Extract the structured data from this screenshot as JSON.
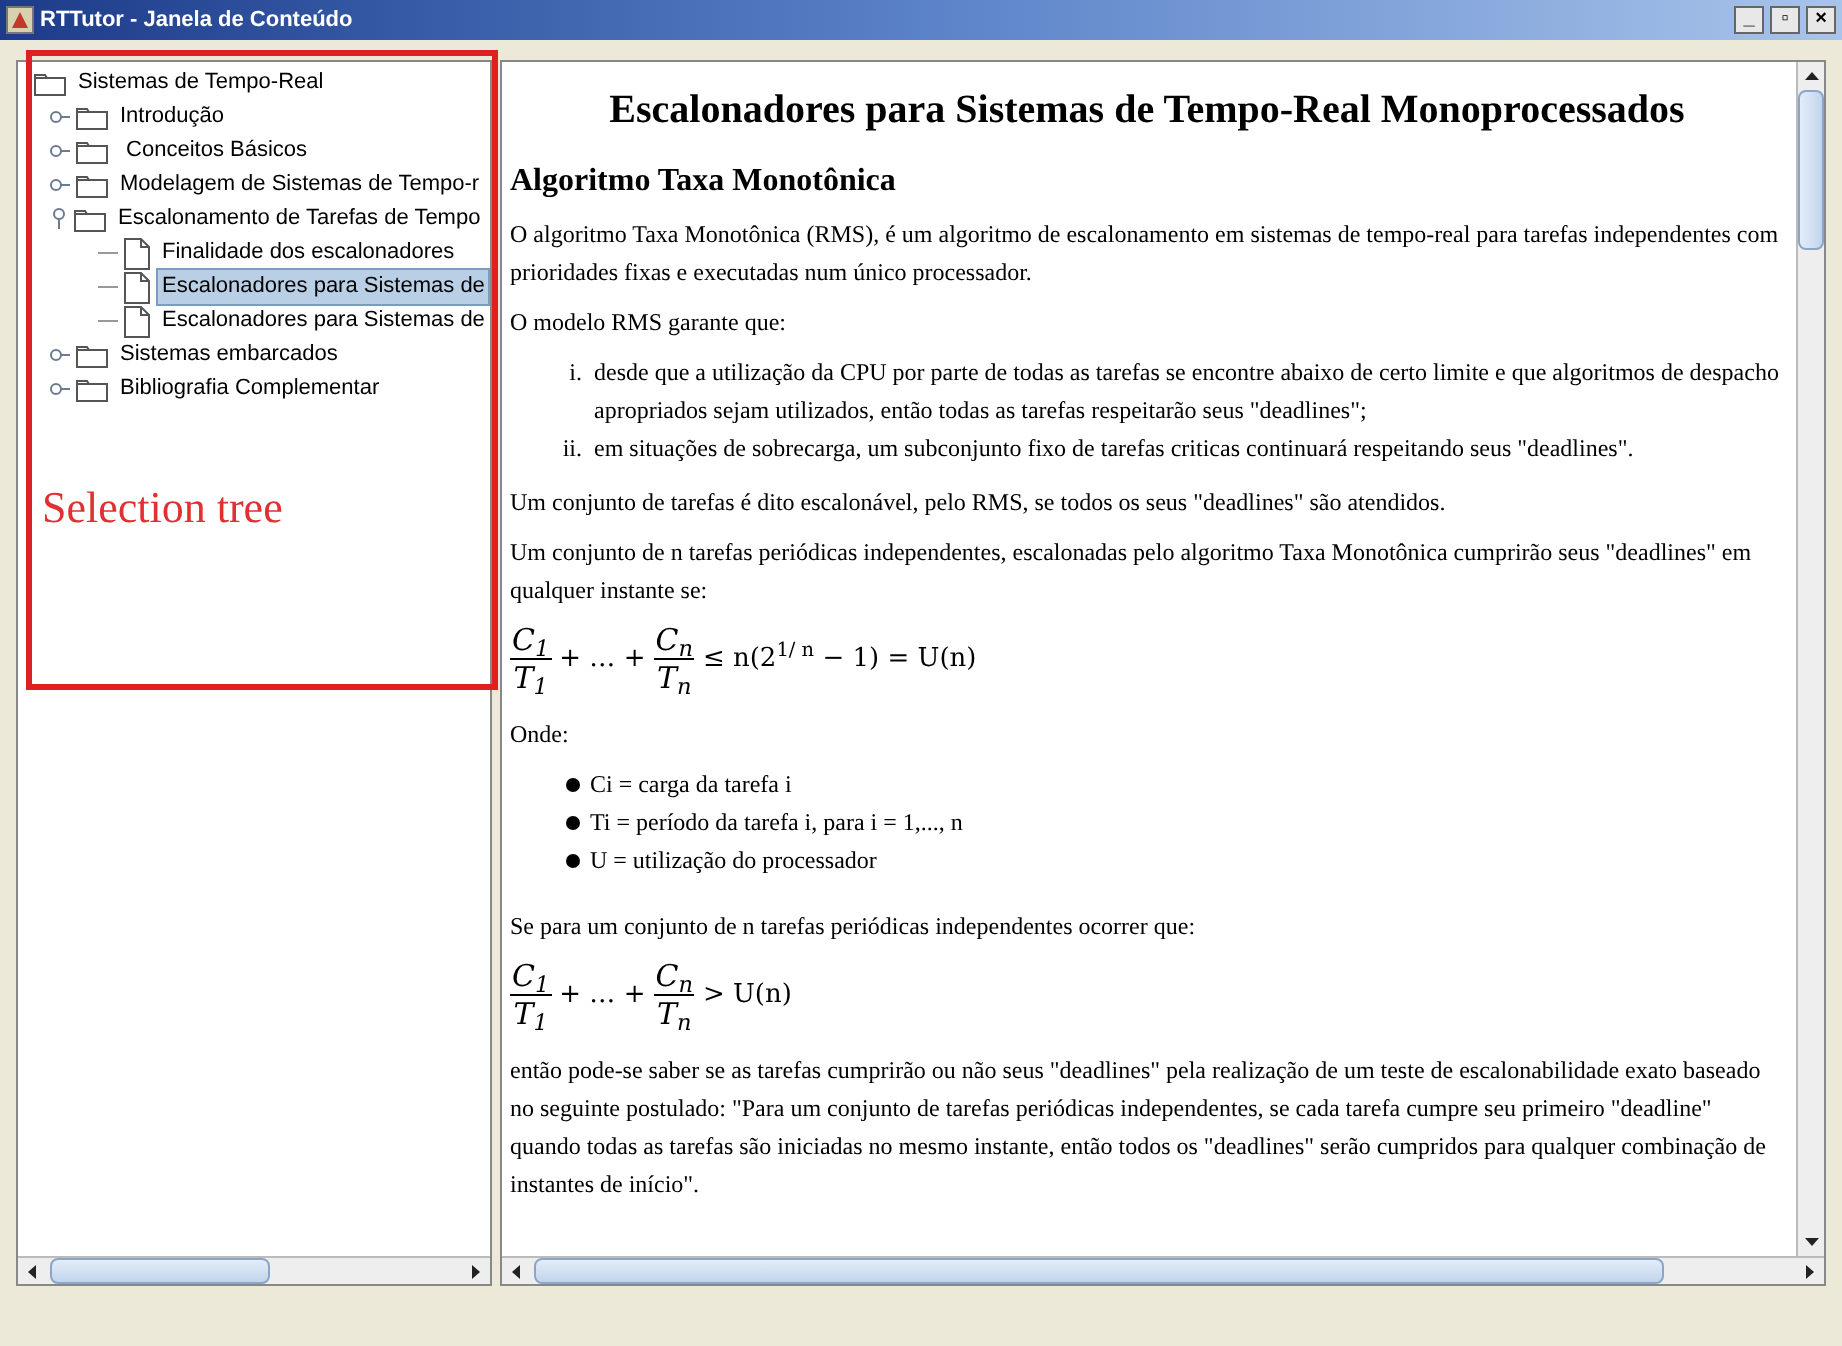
{
  "window": {
    "title": "RTTutor - Janela de Conteúdo",
    "controls": [
      "_",
      "▫",
      "×"
    ]
  },
  "tree": {
    "nodes": [
      {
        "label": "Sistemas de Tempo-Real",
        "kind": "folder",
        "expanded": true,
        "selected": false,
        "children": [
          {
            "label": "Introdução",
            "kind": "folder",
            "expanded": false,
            "selected": false
          },
          {
            "label": " Conceitos Básicos",
            "kind": "folder",
            "expanded": false,
            "selected": false
          },
          {
            "label": "Modelagem de Sistemas de Tempo-r",
            "kind": "folder",
            "expanded": false,
            "selected": false
          },
          {
            "label": "Escalonamento de Tarefas de Tempo",
            "kind": "folder",
            "expanded": true,
            "selected": false,
            "children": [
              {
                "label": "Finalidade dos escalonadores",
                "kind": "doc",
                "selected": false
              },
              {
                "label": "Escalonadores para Sistemas de",
                "kind": "doc",
                "selected": true
              },
              {
                "label": "Escalonadores para Sistemas de",
                "kind": "doc",
                "selected": false
              }
            ]
          },
          {
            "label": "Sistemas embarcados",
            "kind": "folder",
            "expanded": false,
            "selected": false
          },
          {
            "label": "Bibliografia Complementar",
            "kind": "folder",
            "expanded": false,
            "selected": false
          }
        ]
      }
    ]
  },
  "annotation": {
    "label": "Selection tree"
  },
  "content": {
    "title": "Escalonadores para Sistemas de Tempo-Real Monoprocessados",
    "blocks": [
      {
        "kind": "heading",
        "text": "Algoritmo Taxa Monotônica"
      },
      {
        "kind": "paragraph",
        "text": "O algoritmo Taxa Monotônica (RMS), é um algoritmo de escalonamento em sistemas de tempo-real para tarefas independentes com prioridades fixas e executadas num único processador."
      },
      {
        "kind": "paragraph",
        "text": "O modelo RMS garante que:"
      },
      {
        "kind": "numbered",
        "items": [
          {
            "marker": "i.",
            "text": "desde que a utilização da CPU por parte de todas as tarefas se encontre abaixo de certo limite e que algoritmos de despacho apropriados sejam utilizados, então todas as tarefas respeitarão seus \"deadlines\";"
          },
          {
            "marker": "ii.",
            "text": "em situações de sobrecarga, um subconjunto fixo de tarefas criticas continuará respeitando seus \"deadlines\"."
          }
        ]
      },
      {
        "kind": "paragraph",
        "text": "Um conjunto de tarefas é dito escalonável, pelo RMS, se todos os seus \"deadlines\" são atendidos."
      },
      {
        "kind": "paragraph",
        "text": "Um conjunto de n tarefas periódicas independentes, escalonadas pelo algoritmo Taxa Monotônica cumprirão seus \"deadlines\" em qualquer instante se:"
      },
      {
        "kind": "formula",
        "terms": [
          {
            "kind": "fraction",
            "num": "C$_{1}$",
            "den": "T$_{1}$"
          },
          {
            "kind": "text",
            "text": "+ … +"
          },
          {
            "kind": "fraction",
            "num": "C$_{n}$",
            "den": "T$_{n}$"
          },
          {
            "kind": "text",
            "text": "≤ n(2$^{1/ n}$ − 1) = U(n)"
          }
        ]
      },
      {
        "kind": "paragraph",
        "text": "Onde:"
      },
      {
        "kind": "bullets",
        "items": [
          "Ci = carga da tarefa i",
          "Ti = período da tarefa i, para i = 1,..., n",
          "U = utilização do processador"
        ]
      },
      {
        "kind": "paragraph",
        "text": "Se para um conjunto de n tarefas periódicas independentes ocorrer que:"
      },
      {
        "kind": "formula",
        "terms": [
          {
            "kind": "fraction",
            "num": "C$_{1}$",
            "den": "T$_{1}$"
          },
          {
            "kind": "text",
            "text": "+ … +"
          },
          {
            "kind": "fraction",
            "num": "C$_{n}$",
            "den": "T$_{n}$"
          },
          {
            "kind": "text",
            "text": "> U(n)"
          }
        ]
      },
      {
        "kind": "paragraph",
        "text": "então pode-se saber se as tarefas cumprirão ou não seus \"deadlines\" pela realização de um teste de escalonabilidade exato baseado no seguinte postulado: \"Para um conjunto de tarefas periódicas independentes, se cada tarefa cumpre seu primeiro \"deadline\" quando todas as tarefas são iniciadas no mesmo instante, então todos os \"deadlines\" serão cumpridos para qualquer combinação de instantes de início\"."
      }
    ]
  }
}
